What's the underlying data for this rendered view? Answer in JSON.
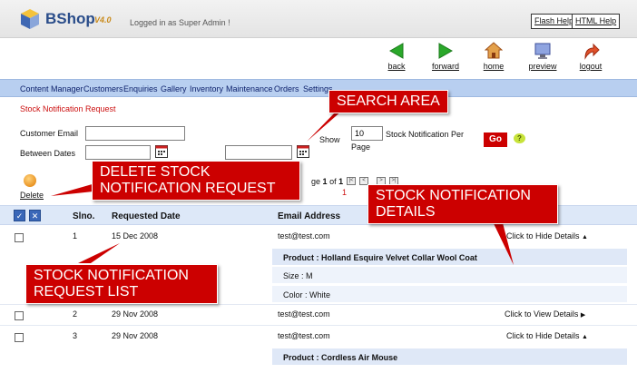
{
  "app": {
    "logo": "BShop",
    "version": "V4.0",
    "logged_in": "Logged in as Super Admin !"
  },
  "header_links": [
    {
      "label": "Flash Help"
    },
    {
      "label": "HTML Help"
    }
  ],
  "nav_buttons": [
    {
      "label": "back",
      "icon": "arrow-left-icon",
      "color": "#2aa82a"
    },
    {
      "label": "forward",
      "icon": "arrow-right-icon",
      "color": "#2aa82a"
    },
    {
      "label": "home",
      "icon": "home-icon",
      "color": "#d05a1c"
    },
    {
      "label": "preview",
      "icon": "monitor-icon",
      "color": "#5b6fc0"
    },
    {
      "label": "logout",
      "icon": "logout-arrow-icon",
      "color": "#d8401c"
    }
  ],
  "menu": [
    {
      "label": "Content Manager"
    },
    {
      "label": "Customers"
    },
    {
      "label": "Enquiries"
    },
    {
      "label": "Gallery"
    },
    {
      "label": "Inventory"
    },
    {
      "label": "Maintenance"
    },
    {
      "label": "Orders"
    },
    {
      "label": "Settings"
    }
  ],
  "page_title": "Stock Notification Request",
  "search": {
    "email_label": "Customer Email",
    "between_label": "Between Dates",
    "show_label": "Show",
    "per_page_value": "10",
    "per_page_label": "Stock Notification Per",
    "page_label": "Page",
    "go_label": "Go",
    "help_label": "?"
  },
  "toolbar": {
    "delete_label": "Delete"
  },
  "pager": {
    "prefix": "ge",
    "current": "1",
    "of": "of",
    "total": "1",
    "page_number": "1"
  },
  "table": {
    "headers": {
      "slno": "Slno.",
      "date": "Requested Date",
      "email": "Email Address"
    },
    "rows": [
      {
        "slno": "1",
        "date": "15 Dec 2008",
        "email": "test@test.com",
        "toggle": "Click to Hide Details",
        "arrow": "▲"
      },
      {
        "slno": "2",
        "date": "29 Nov 2008",
        "email": "test@test.com",
        "toggle": "Click to View Details",
        "arrow": "▶"
      },
      {
        "slno": "3",
        "date": "29 Nov 2008",
        "email": "test@test.com",
        "toggle": "Click to Hide Details",
        "arrow": "▲"
      }
    ],
    "details1": {
      "product": "Product : Holland Esquire Velvet Collar Wool Coat",
      "size": "Size : M",
      "color": "Color : White"
    },
    "details3": {
      "product": "Product : Cordless Air Mouse"
    }
  },
  "callouts": {
    "search": "SEARCH AREA",
    "delete_line1": "DELETE  STOCK",
    "delete_line2": "NOTIFICATION REQUEST",
    "details_line1": "STOCK  NOTIFICATION",
    "details_line2": "DETAILS",
    "list_line1": "STOCK  NOTIFICATION",
    "list_line2": "REQUEST LIST"
  },
  "colors": {
    "accent_red": "#cc0000",
    "menu_bg": "#b8cff0",
    "header_row_bg": "#dde8f8"
  }
}
